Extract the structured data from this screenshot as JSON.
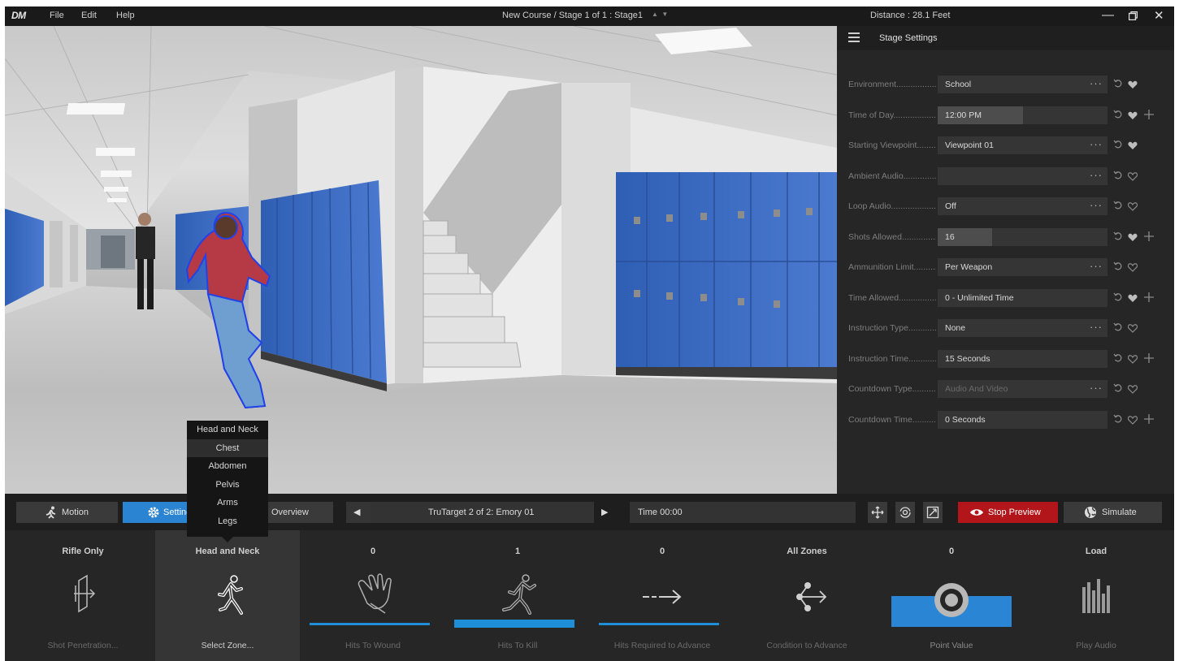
{
  "titlebar": {
    "logo": "DM",
    "menu": [
      "File",
      "Edit",
      "Help"
    ],
    "course_title": "New Course / Stage 1 of 1 : Stage1",
    "distance": "Distance : 28.1 Feet"
  },
  "settings": {
    "title": "Stage Settings",
    "rows": [
      {
        "label": "Environment........................",
        "value": "School",
        "dots": true,
        "heart": "filled",
        "plus": false,
        "disabled": false
      },
      {
        "label": "Time of Day........................",
        "value": "12:00 PM",
        "dots": false,
        "heart": "filled",
        "plus": true,
        "disabled": false,
        "fill": 0.5
      },
      {
        "label": "Starting Viewpoint.................",
        "value": "Viewpoint 01",
        "dots": true,
        "heart": "filled",
        "plus": false,
        "disabled": false
      },
      {
        "label": "Ambient Audio......................",
        "value": "",
        "dots": true,
        "heart": "outline",
        "plus": false,
        "disabled": false
      },
      {
        "label": "Loop Audio.........................",
        "value": "Off",
        "dots": true,
        "heart": "outline",
        "plus": false,
        "disabled": false
      },
      {
        "label": "Shots Allowed......................",
        "value": "16",
        "dots": false,
        "heart": "filled",
        "plus": true,
        "disabled": false,
        "fill": 0.32
      },
      {
        "label": "Ammunition Limit...................",
        "value": "Per Weapon",
        "dots": true,
        "heart": "outline",
        "plus": false,
        "disabled": false
      },
      {
        "label": "Time Allowed.......................",
        "value": "0 - Unlimited Time",
        "dots": false,
        "heart": "filled",
        "plus": true,
        "disabled": false
      },
      {
        "label": "Instruction Type...................",
        "value": "None",
        "dots": true,
        "heart": "outline",
        "plus": false,
        "disabled": false
      },
      {
        "label": "Instruction Time...................",
        "value": "15 Seconds",
        "dots": false,
        "heart": "outline",
        "plus": true,
        "disabled": false
      },
      {
        "label": "Countdown Type.....................",
        "value": "Audio And Video",
        "dots": true,
        "heart": "outline",
        "plus": false,
        "disabled": true
      },
      {
        "label": "Countdown Time.....................",
        "value": "0 Seconds",
        "dots": false,
        "heart": "outline",
        "plus": true,
        "disabled": false
      }
    ]
  },
  "toolbar": {
    "motion": "Motion",
    "settings": "Settings",
    "overview": "Overview",
    "target": "TruTarget 2 of 2: Emory 01",
    "time": "Time 00:00",
    "stop_preview": "Stop Preview",
    "simulate": "Simulate"
  },
  "zone_menu": {
    "items": [
      "Head and Neck",
      "Chest",
      "Abdomen",
      "Pelvis",
      "Arms",
      "Legs"
    ],
    "highlighted": "Chest"
  },
  "bottom": [
    {
      "value": "Rifle Only",
      "caption": "Shot Penetration...",
      "icon": "shot-penetration-icon"
    },
    {
      "value": "Head and Neck",
      "caption": "Select Zone...",
      "icon": "zone-figure-icon"
    },
    {
      "value": "0",
      "caption": "Hits To Wound",
      "icon": "wound-hand-icon"
    },
    {
      "value": "1",
      "caption": "Hits To Kill",
      "icon": "kill-figure-icon"
    },
    {
      "value": "0",
      "caption": "Hits Required to Advance",
      "icon": "advance-arrow-icon"
    },
    {
      "value": "All Zones",
      "caption": "Condition to Advance",
      "icon": "condition-branch-icon"
    },
    {
      "value": "0",
      "caption": "Point Value",
      "icon": "target-icon"
    },
    {
      "value": "Load",
      "caption": "Play Audio",
      "icon": "audio-bars-icon"
    }
  ],
  "colors": {
    "accent_blue": "#2a84d2",
    "stop_red": "#b3161a",
    "slider_blue": "#1e8fd6",
    "locker_blue": "#3f6fc4"
  }
}
